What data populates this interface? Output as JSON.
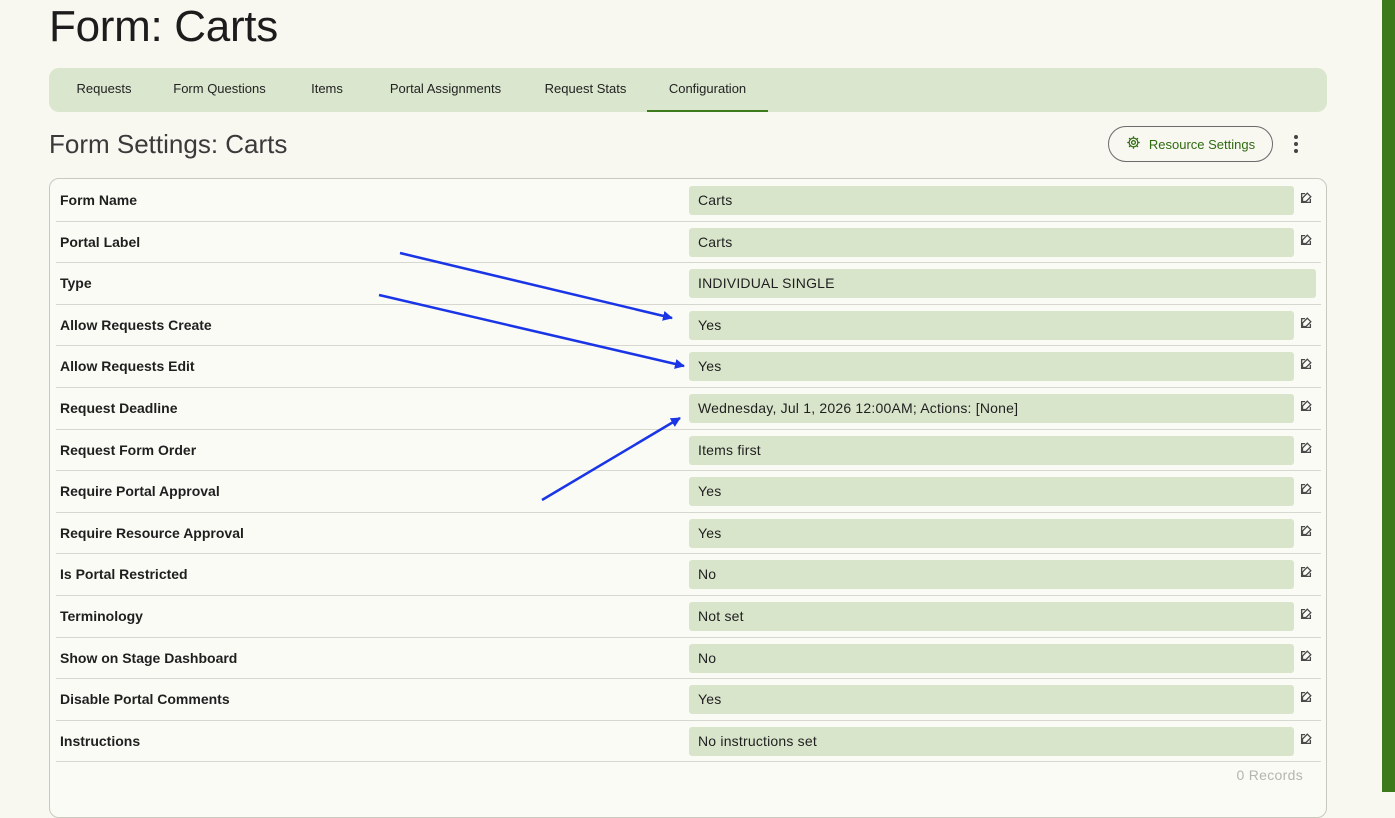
{
  "page": {
    "title": "Form: Carts"
  },
  "tabs": [
    {
      "label": "Requests"
    },
    {
      "label": "Form Questions"
    },
    {
      "label": "Items"
    },
    {
      "label": "Portal Assignments"
    },
    {
      "label": "Request Stats"
    },
    {
      "label": "Configuration",
      "active": true
    }
  ],
  "section": {
    "title": "Form Settings: Carts"
  },
  "toolbar": {
    "resource_settings_label": "Resource Settings"
  },
  "settings": [
    {
      "label": "Form Name",
      "value": "Carts",
      "editable": true
    },
    {
      "label": "Portal Label",
      "value": "Carts",
      "editable": true
    },
    {
      "label": "Type",
      "value": "INDIVIDUAL SINGLE",
      "editable": false
    },
    {
      "label": "Allow Requests Create",
      "value": "Yes",
      "editable": true
    },
    {
      "label": "Allow Requests Edit",
      "value": "Yes",
      "editable": true
    },
    {
      "label": "Request Deadline",
      "value": "Wednesday, Jul 1, 2026 12:00AM; Actions: [None]",
      "editable": true
    },
    {
      "label": "Request Form Order",
      "value": "Items first",
      "editable": true
    },
    {
      "label": "Require Portal Approval",
      "value": "Yes",
      "editable": true
    },
    {
      "label": "Require Resource Approval",
      "value": "Yes",
      "editable": true
    },
    {
      "label": "Is Portal Restricted",
      "value": "No",
      "editable": true
    },
    {
      "label": "Terminology",
      "value": "Not set",
      "editable": true
    },
    {
      "label": "Show on Stage Dashboard",
      "value": "No",
      "editable": true
    },
    {
      "label": "Disable Portal Comments",
      "value": "Yes",
      "editable": true
    },
    {
      "label": "Instructions",
      "value": "No instructions set",
      "editable": true
    }
  ],
  "footer": {
    "records_label": "0 Records"
  },
  "colors": {
    "accent": "#3d7a1c",
    "tab_bar": "#dae6cd",
    "value_bg": "#d9e5cb",
    "annotation_arrow": "#1a35e6"
  },
  "icons": {
    "settings_button": "gear-icon",
    "row_action": "edit-icon",
    "overflow_menu": "kebab-menu-icon"
  }
}
